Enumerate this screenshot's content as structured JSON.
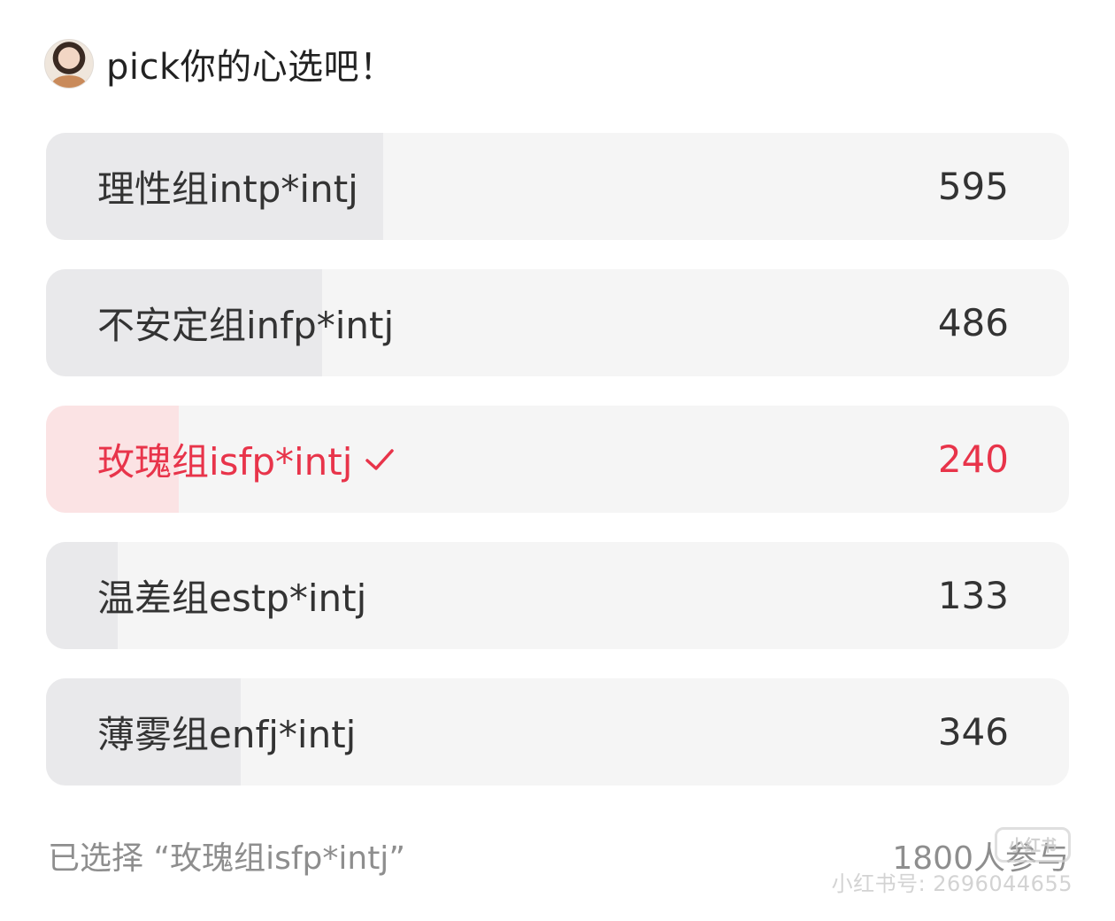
{
  "header": {
    "title": "pick你的心选吧！"
  },
  "poll": {
    "selected_color": "#e8344a",
    "options": [
      {
        "label": "理性组intp*intj",
        "count": "595",
        "fraction": 0.33,
        "selected": false
      },
      {
        "label": "不安定组infp*intj",
        "count": "486",
        "fraction": 0.27,
        "selected": false
      },
      {
        "label": "玫瑰组isfp*intj",
        "count": "240",
        "fraction": 0.13,
        "selected": true
      },
      {
        "label": "温差组estp*intj",
        "count": "133",
        "fraction": 0.07,
        "selected": false
      },
      {
        "label": "薄雾组enfj*intj",
        "count": "346",
        "fraction": 0.19,
        "selected": false
      }
    ]
  },
  "footer": {
    "selected_text": "已选择 “玫瑰组isfp*intj”",
    "participants": "1800人参与"
  },
  "watermark": {
    "logo": "小红书",
    "id_text": "小红书号: 2696044655"
  }
}
